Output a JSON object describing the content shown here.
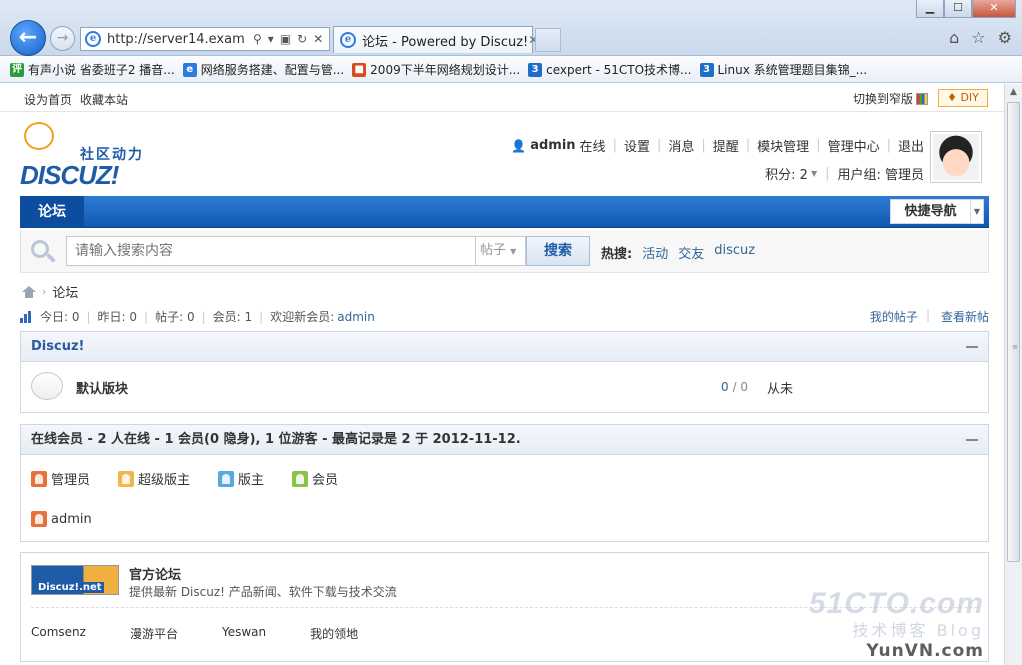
{
  "browser": {
    "address": "http://server14.examp...",
    "tab_title": "论坛 - Powered by Discuz!",
    "window_buttons": {
      "min": "▁",
      "max": "☐",
      "close": "✕"
    },
    "favorites": [
      {
        "label": "有声小说 省委班子2 播音...",
        "icon_text": "评",
        "color": "#2a9d3a"
      },
      {
        "label": "网络服务搭建、配置与管...",
        "icon_text": "e",
        "color": "#2d7be0"
      },
      {
        "label": "2009下半年网络规划设计...",
        "icon_text": "■",
        "color": "#d94a1e"
      },
      {
        "label": "cexpert - 51CTO技术博...",
        "icon_text": "3",
        "color": "#1e6fc9"
      },
      {
        "label": "Linux 系统管理题目集锦_...",
        "icon_text": "3",
        "color": "#1e6fc9"
      }
    ]
  },
  "topbar": {
    "set_home": "设为首页",
    "bookmark": "收藏本站",
    "switch_width": "切换到窄版",
    "diy": "♦ DIY"
  },
  "logo": {
    "slogan": "社区动力",
    "word": "DISCUZ!"
  },
  "user": {
    "name": "admin",
    "online": "在线",
    "links": [
      "设置",
      "消息",
      "提醒",
      "模块管理",
      "管理中心",
      "退出"
    ],
    "credits": "积分: 2",
    "group": "用户组: 管理员"
  },
  "nav": {
    "active": "论坛",
    "quick": "快捷导航"
  },
  "search": {
    "placeholder": "请输入搜索内容",
    "type": "帖子",
    "button": "搜索",
    "hot_label": "热搜:",
    "hot": [
      "活动",
      "交友",
      "discuz"
    ]
  },
  "breadcrumb": {
    "current": "论坛"
  },
  "stats": {
    "today": "今日: 0",
    "yesterday": "昨日: 0",
    "posts": "帖子: 0",
    "members": "会员: 1",
    "welcome": "欢迎新会员:",
    "newest": "admin",
    "my_posts": "我的帖子",
    "new_posts": "查看新帖"
  },
  "category": {
    "title": "Discuz!",
    "forum": {
      "name": "默认版块",
      "threads": "0",
      "posts": "0",
      "last": "从未"
    }
  },
  "online": {
    "title": "在线会员",
    "summary": " - 2 人在线  - 1 会员(0 隐身), 1 位游客  - 最高记录是  2 于  2012-11-12.",
    "legend": [
      {
        "label": "管理员",
        "color": "#e8733a"
      },
      {
        "label": "超级版主",
        "color": "#f2b64a"
      },
      {
        "label": "版主",
        "color": "#5aa8e0"
      },
      {
        "label": "会员",
        "color": "#8bc34a"
      }
    ],
    "user": "admin"
  },
  "links": {
    "logo_text": "Discuz!.net",
    "title": "官方论坛",
    "desc": "提供最新 Discuz! 产品新闻、软件下载与技术交流",
    "items": [
      "Comsenz",
      "漫游平台",
      "Yeswan",
      "我的领地"
    ]
  },
  "watermark": {
    "top": "51CTO.com",
    "mid": "技术博客 Blog",
    "bottom": "YunVN.com"
  }
}
